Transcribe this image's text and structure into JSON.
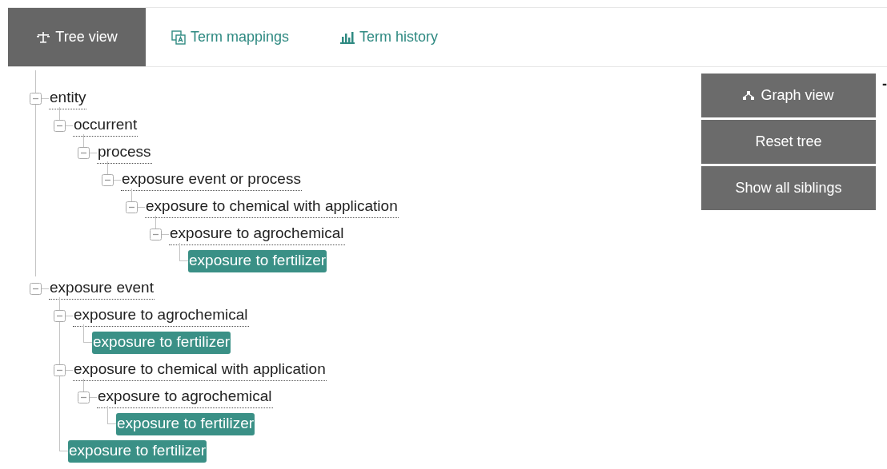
{
  "tabs": [
    {
      "label": "Tree view",
      "kind": "tree",
      "selected": true
    },
    {
      "label": "Term mappings",
      "kind": "mappings",
      "selected": false
    },
    {
      "label": "Term history",
      "kind": "history",
      "selected": false
    }
  ],
  "tree": [
    {
      "label": "entity",
      "selected": false,
      "expanded": true,
      "children": [
        {
          "label": "occurrent",
          "selected": false,
          "expanded": true,
          "children": [
            {
              "label": "process",
              "selected": false,
              "expanded": true,
              "children": [
                {
                  "label": "exposure event or process",
                  "selected": false,
                  "expanded": true,
                  "children": [
                    {
                      "label": "exposure to chemical with application",
                      "selected": false,
                      "expanded": true,
                      "children": [
                        {
                          "label": "exposure to agrochemical",
                          "selected": false,
                          "expanded": true,
                          "children": [
                            {
                              "label": "exposure to fertilizer",
                              "selected": true
                            }
                          ]
                        }
                      ]
                    }
                  ]
                }
              ]
            }
          ]
        }
      ]
    },
    {
      "label": "exposure event",
      "selected": false,
      "expanded": true,
      "children": [
        {
          "label": "exposure to agrochemical",
          "selected": false,
          "expanded": true,
          "children": [
            {
              "label": "exposure to fertilizer",
              "selected": true
            }
          ]
        },
        {
          "label": "exposure to chemical with application",
          "selected": false,
          "expanded": true,
          "children": [
            {
              "label": "exposure to agrochemical",
              "selected": false,
              "expanded": true,
              "children": [
                {
                  "label": "exposure to fertilizer",
                  "selected": true
                }
              ]
            }
          ]
        },
        {
          "label": "exposure to fertilizer",
          "selected": true
        }
      ]
    }
  ],
  "actions": [
    {
      "label": "Graph view",
      "kind": "graph"
    },
    {
      "label": "Reset tree",
      "kind": "reset"
    },
    {
      "label": "Show all siblings",
      "kind": "siblings"
    }
  ],
  "edge_mark": "-"
}
